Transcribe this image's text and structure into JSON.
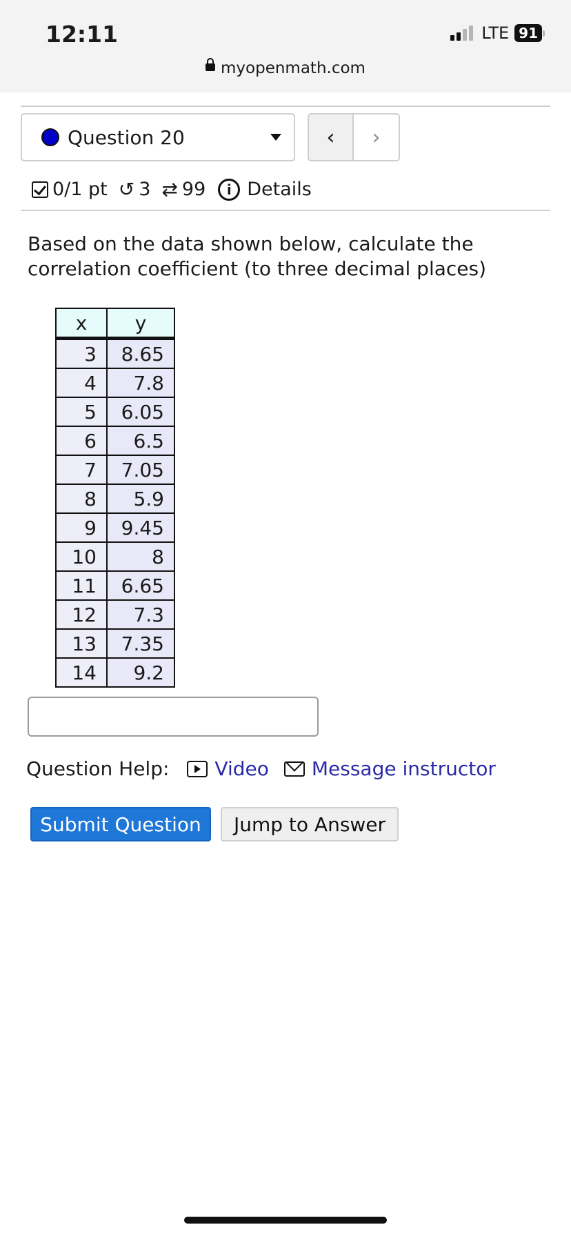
{
  "status_bar": {
    "time": "12:11",
    "network": "LTE",
    "battery": "91"
  },
  "browser": {
    "url": "myopenmath.com"
  },
  "question_nav": {
    "selected": "Question 20",
    "prev_icon": "chevron-left-icon",
    "next_icon": "chevron-right-icon",
    "status_color": "#0000c8"
  },
  "meta": {
    "score": "0/1 pt",
    "attempts": "3",
    "regens": "99",
    "details_label": "Details"
  },
  "question": {
    "prompt": "Based on the data shown below, calculate the correlation coefficient (to three decimal places)",
    "table": {
      "headers": [
        "x",
        "y"
      ],
      "rows": [
        [
          "3",
          "8.65"
        ],
        [
          "4",
          "7.8"
        ],
        [
          "5",
          "6.05"
        ],
        [
          "6",
          "6.5"
        ],
        [
          "7",
          "7.05"
        ],
        [
          "8",
          "5.9"
        ],
        [
          "9",
          "9.45"
        ],
        [
          "10",
          "8"
        ],
        [
          "11",
          "6.65"
        ],
        [
          "12",
          "7.3"
        ],
        [
          "13",
          "7.35"
        ],
        [
          "14",
          "9.2"
        ]
      ]
    },
    "answer_value": ""
  },
  "help": {
    "label": "Question Help:",
    "video_label": "Video",
    "message_label": "Message instructor"
  },
  "actions": {
    "submit_label": "Submit Question",
    "jump_label": "Jump to Answer"
  },
  "colors": {
    "submit_bg": "#1f77d8",
    "link": "#2a2aa8"
  }
}
